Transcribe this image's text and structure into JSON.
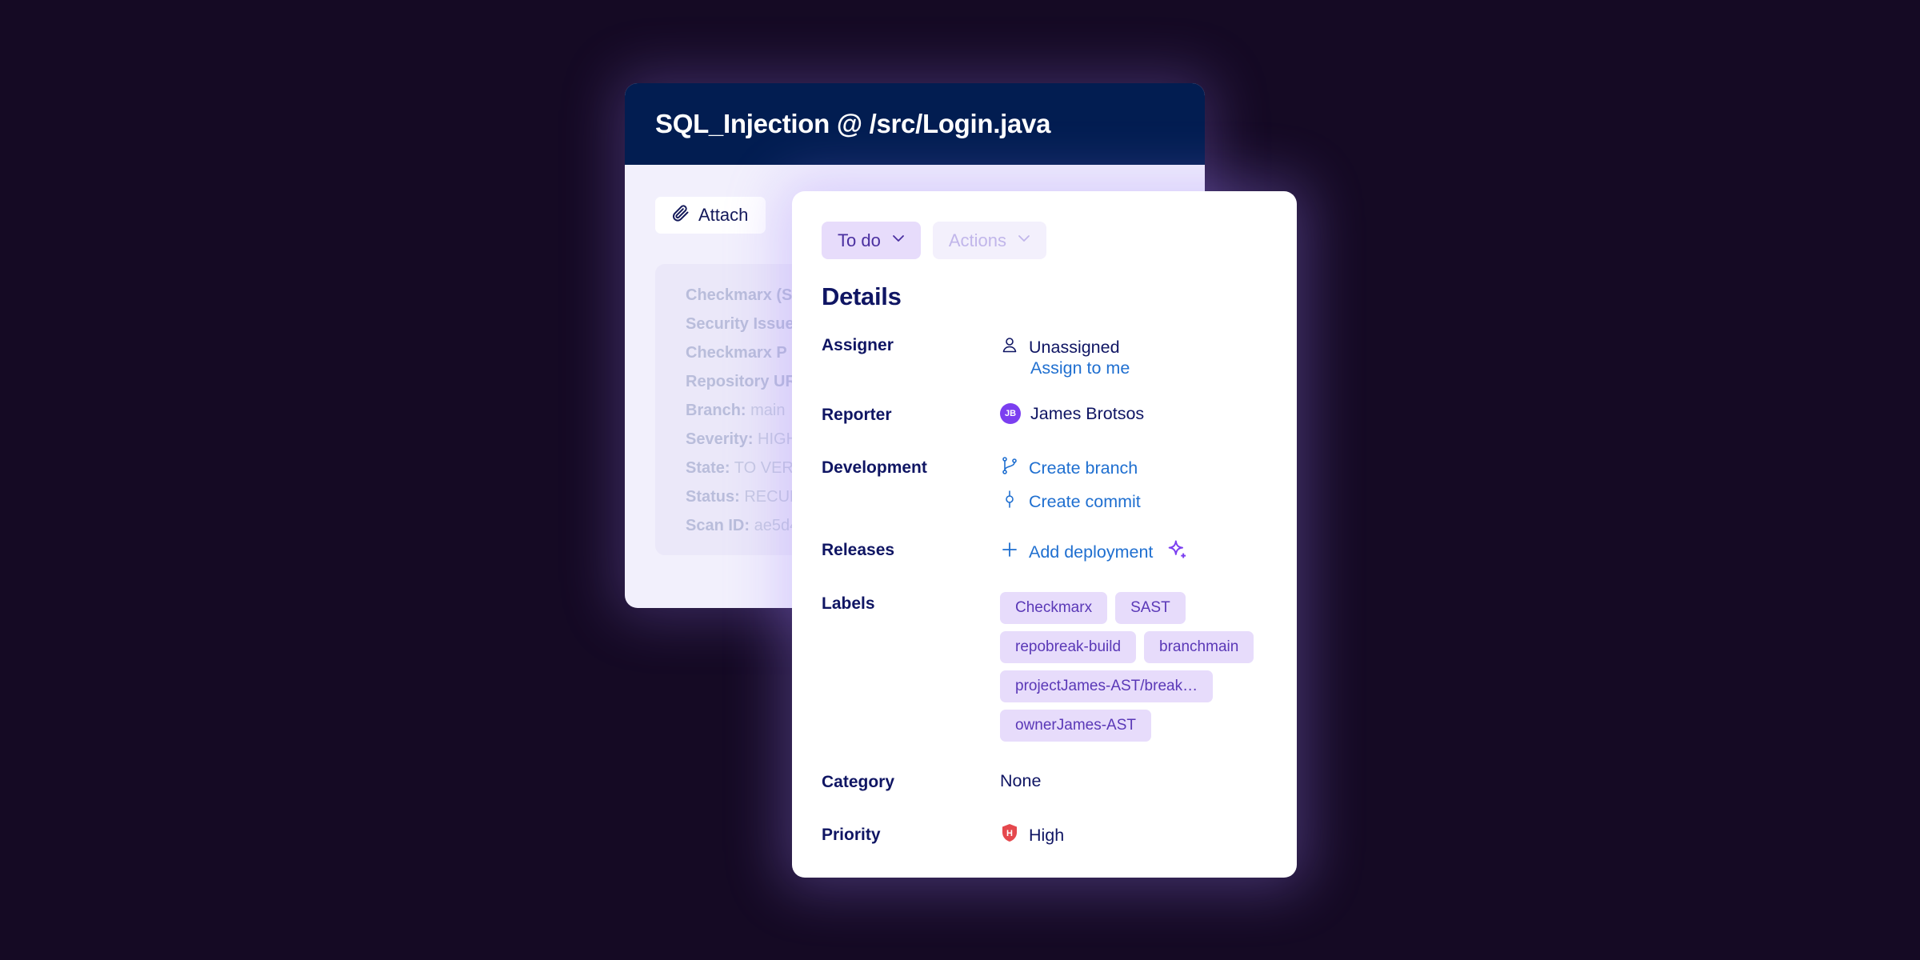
{
  "issue": {
    "title": "SQL_Injection @ /src/Login.java",
    "attach_label": "Attach",
    "description_lines": [
      {
        "key": "Checkmarx (S",
        "value": ""
      },
      {
        "key": "Security Issue",
        "value": ""
      },
      {
        "key": "Checkmarx P",
        "value": ""
      },
      {
        "key": "Repository UR",
        "value": ""
      },
      {
        "key": "Branch:",
        "value": " main"
      },
      {
        "key": "Severity:",
        "value": " HIGH"
      },
      {
        "key": "State:",
        "value": " TO VER"
      },
      {
        "key": "Status:",
        "value": " RECUR"
      },
      {
        "key": "Scan ID:",
        "value": " ae5d4"
      }
    ]
  },
  "panel": {
    "status_label": "To do",
    "actions_label": "Actions",
    "heading": "Details",
    "assigner": {
      "label": "Assigner",
      "value": "Unassigned",
      "link": "Assign to me"
    },
    "reporter": {
      "label": "Reporter",
      "initials": "JB",
      "name": "James Brotsos"
    },
    "development": {
      "label": "Development",
      "branch": "Create branch",
      "commit": "Create commit"
    },
    "releases": {
      "label": "Releases",
      "add": "Add deployment"
    },
    "labels": {
      "label": "Labels",
      "items": [
        "Checkmarx",
        "SAST",
        "repobreak-build",
        "branchmain",
        "projectJames-AST/break…",
        "ownerJames-AST"
      ]
    },
    "category": {
      "label": "Category",
      "value": "None"
    },
    "priority": {
      "label": "Priority",
      "value": "High",
      "icon_letter": "H"
    }
  },
  "colors": {
    "background": "#150a24",
    "header": "#021d51",
    "heading_text": "#0f1563",
    "link": "#1f6fd0",
    "tag_bg": "#e7dcfb",
    "tag_text": "#5a38b7",
    "priority_red": "#e5484d",
    "avatar": "#7b3ff0"
  },
  "icons": [
    "paperclip-icon",
    "chevron-down-icon",
    "user-icon",
    "git-branch-icon",
    "git-commit-icon",
    "plus-icon",
    "sparkle-icon",
    "priority-high-icon"
  ]
}
